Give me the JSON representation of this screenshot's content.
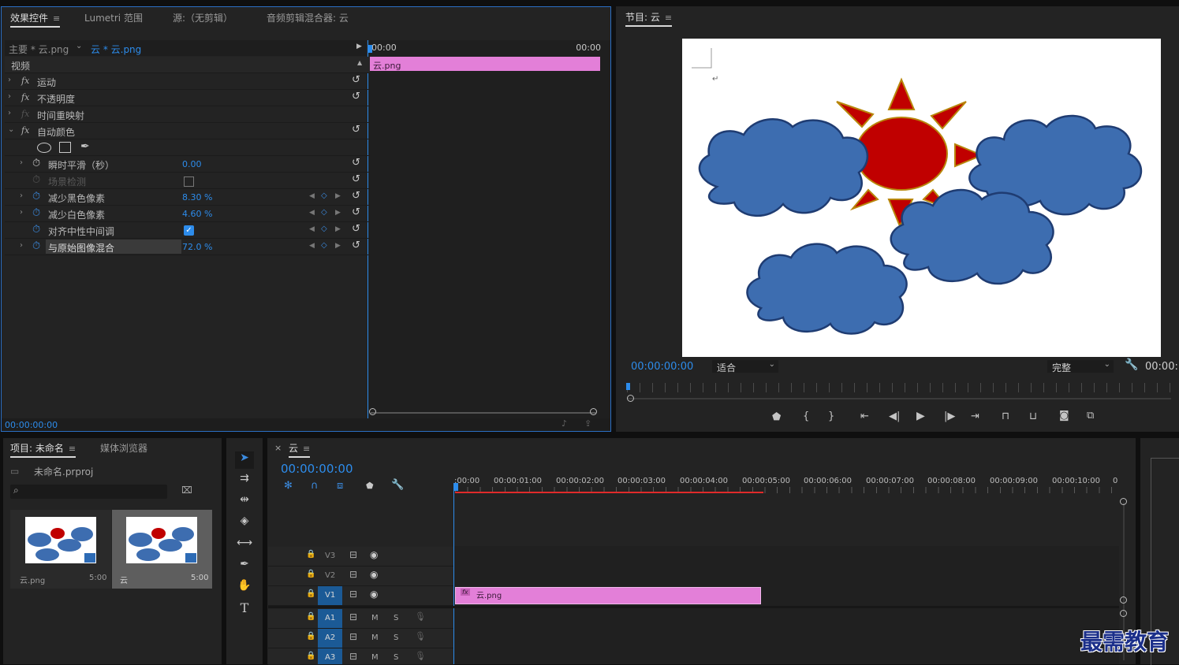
{
  "effect_controls": {
    "tabs": [
      "效果控件",
      "Lumetri 范围",
      "源:（无剪辑）",
      "音频剪辑混合器: 云"
    ],
    "menu_glyph": "≡",
    "master_label": "主要 * 云.png",
    "clip_selector": "云 * 云.png",
    "timeline_start": "00:00",
    "timeline_end": "00:00",
    "clip_bar_label": "云.png",
    "section_video": "视频",
    "effects": [
      {
        "fx": "fx",
        "label": "运动"
      },
      {
        "fx": "fx",
        "label": "不透明度"
      },
      {
        "fx": "fx",
        "label": "时间重映射"
      },
      {
        "fx": "fx",
        "label": "自动颜色"
      }
    ],
    "params": [
      {
        "label": "瞬时平滑（秒）",
        "value": "0.00"
      },
      {
        "label": "场景检测",
        "value": ""
      },
      {
        "label": "减少黑色像素",
        "value": "8.30 %"
      },
      {
        "label": "减少白色像素",
        "value": "4.60 %"
      },
      {
        "label": "对齐中性中间调",
        "value": ""
      },
      {
        "label": "与原始图像混合",
        "value": "72.0 %"
      }
    ],
    "footer_timecode": "00:00:00:00"
  },
  "program_monitor": {
    "title": "节目: 云",
    "menu_glyph": "≡",
    "timecode": "00:00:00:00",
    "fit": "适合",
    "quality": "完整",
    "timecode_right": "00:00:"
  },
  "project": {
    "tabs": [
      "项目: 未命名",
      "媒体浏览器"
    ],
    "menu_glyph": "≡",
    "file": "未命名.prproj",
    "items": [
      {
        "name": "云.png",
        "duration": "5:00"
      },
      {
        "name": "云",
        "duration": "5:00"
      }
    ]
  },
  "timeline": {
    "close": "×",
    "name": "云",
    "menu_glyph": "≡",
    "timecode": "00:00:00:00",
    "ruler": [
      ":00:00",
      "00:00:01:00",
      "00:00:02:00",
      "00:00:03:00",
      "00:00:04:00",
      "00:00:05:00",
      "00:00:06:00",
      "00:00:07:00",
      "00:00:08:00",
      "00:00:09:00",
      "00:00:10:00",
      "0"
    ],
    "tracks": [
      {
        "name": "V3"
      },
      {
        "name": "V2"
      },
      {
        "name": "V1"
      },
      {
        "name": "A1"
      },
      {
        "name": "A2"
      },
      {
        "name": "A3"
      }
    ],
    "mute": "M",
    "solo": "S",
    "clip_label": "云.png",
    "clip_fx": "fx"
  },
  "watermark": "最需教育",
  "colors": {
    "accent": "#2d8ceb",
    "clip": "#e37fd8",
    "panel": "#232323",
    "border_active": "#2b6fc4"
  }
}
